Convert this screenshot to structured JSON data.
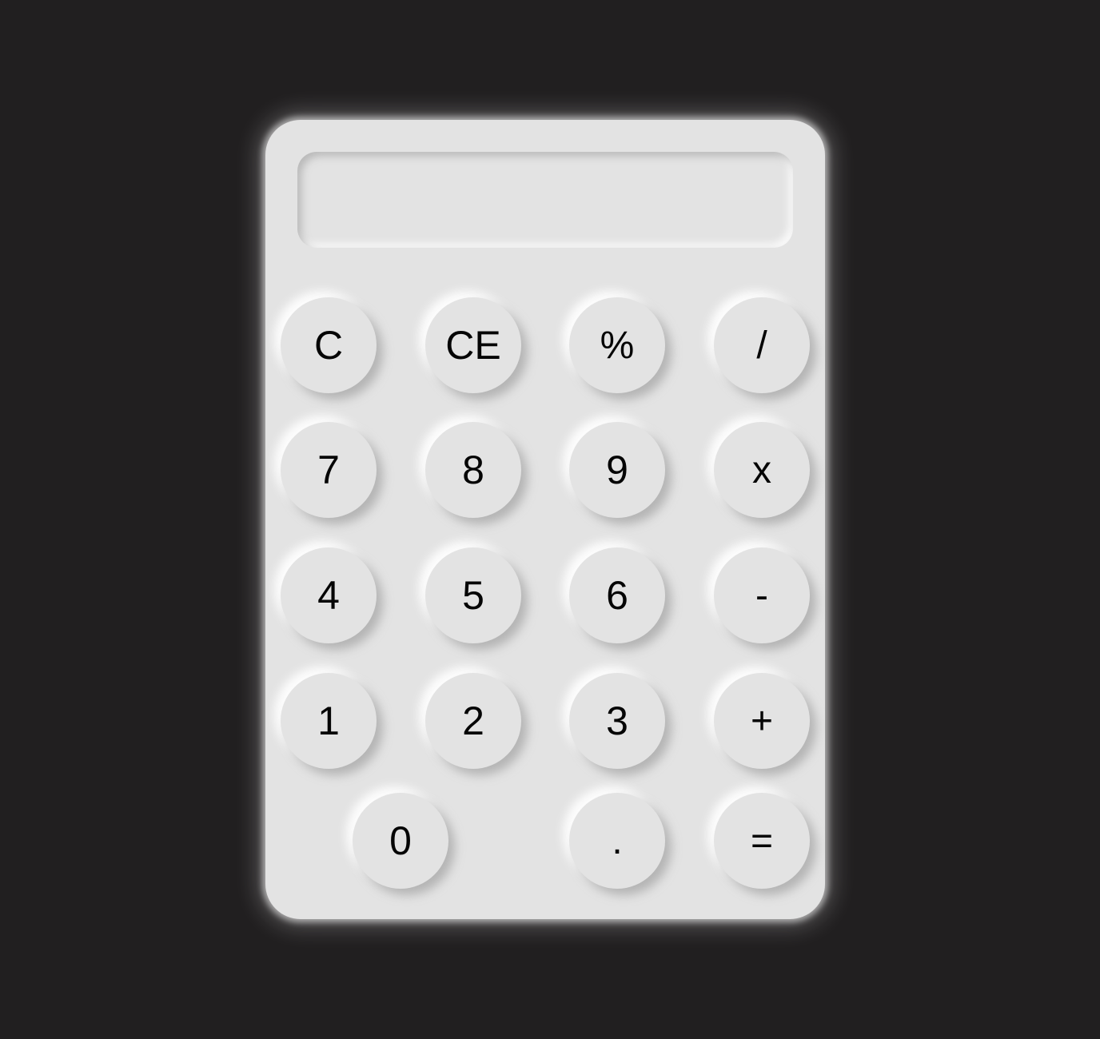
{
  "calculator": {
    "display_value": "",
    "keys": {
      "clear": "C",
      "clear_entry": "CE",
      "percent": "%",
      "divide": "/",
      "seven": "7",
      "eight": "8",
      "nine": "9",
      "multiply": "x",
      "four": "4",
      "five": "5",
      "six": "6",
      "subtract": "-",
      "one": "1",
      "two": "2",
      "three": "3",
      "add": "+",
      "zero": "0",
      "decimal": ".",
      "equals": "="
    }
  },
  "colors": {
    "background": "#211f20",
    "body": "#e3e3e3",
    "text": "#050505"
  }
}
